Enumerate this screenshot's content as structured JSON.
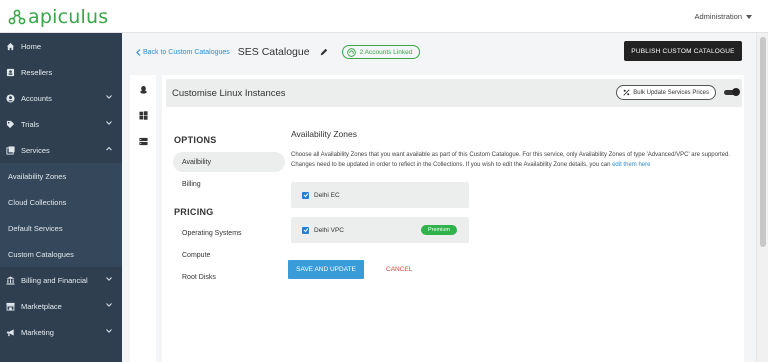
{
  "brand": {
    "name": "apiculus",
    "color": "#3aa64a"
  },
  "header": {
    "user_menu": "Administration"
  },
  "sidebar": {
    "items": [
      {
        "label": "Home",
        "icon": "home-icon"
      },
      {
        "label": "Resellers",
        "icon": "resellers-icon"
      },
      {
        "label": "Accounts",
        "icon": "user-icon",
        "expand": "down"
      },
      {
        "label": "Trials",
        "icon": "tag-icon",
        "expand": "down"
      },
      {
        "label": "Services",
        "icon": "services-icon",
        "expand": "up"
      }
    ],
    "sub_items": [
      {
        "label": "Availability Zones"
      },
      {
        "label": "Cloud Collections"
      },
      {
        "label": "Default Services"
      },
      {
        "label": "Custom Catalogues"
      }
    ],
    "more_items": [
      {
        "label": "Billing and Financial",
        "icon": "bank-icon"
      },
      {
        "label": "Marketplace",
        "icon": "store-icon"
      },
      {
        "label": "Marketing",
        "icon": "megaphone-icon"
      }
    ]
  },
  "breadcrumb": {
    "back_label": "Back to Custom Catalogues",
    "title": "SES Catalogue",
    "linked_label": "2 Accounts Linked"
  },
  "actions": {
    "publish_label": "PUBLISH CUSTOM CATALOGUE"
  },
  "card": {
    "title": "Customise Linux Instances",
    "bulk_label": "Bulk Update Services Prices",
    "toggle_on": true
  },
  "options": {
    "heading": "OPTIONS",
    "items": [
      "Availbility",
      "Billing"
    ],
    "active_index": 0
  },
  "pricing": {
    "heading": "PRICING",
    "items": [
      "Operating Systems",
      "Compute",
      "Root Disks"
    ]
  },
  "zones": {
    "title": "Availability Zones",
    "description": "Choose all Availability Zones that you want available as part of this Custom Catalogue. For this service, only Availability Zones of type 'Advanced/VPC' are supported. Changes need to be updated in order to reflect in the Collections. If you wish to edit the Availability Zone details, you can",
    "description_link": "edit them here",
    "items": [
      {
        "name": "Delhi EC",
        "checked": true
      },
      {
        "name": "Delhi VPC",
        "checked": true,
        "badge": "Premium"
      }
    ]
  },
  "form": {
    "save_label": "SAVE AND UPDATE",
    "cancel_label": "CANCEL"
  }
}
